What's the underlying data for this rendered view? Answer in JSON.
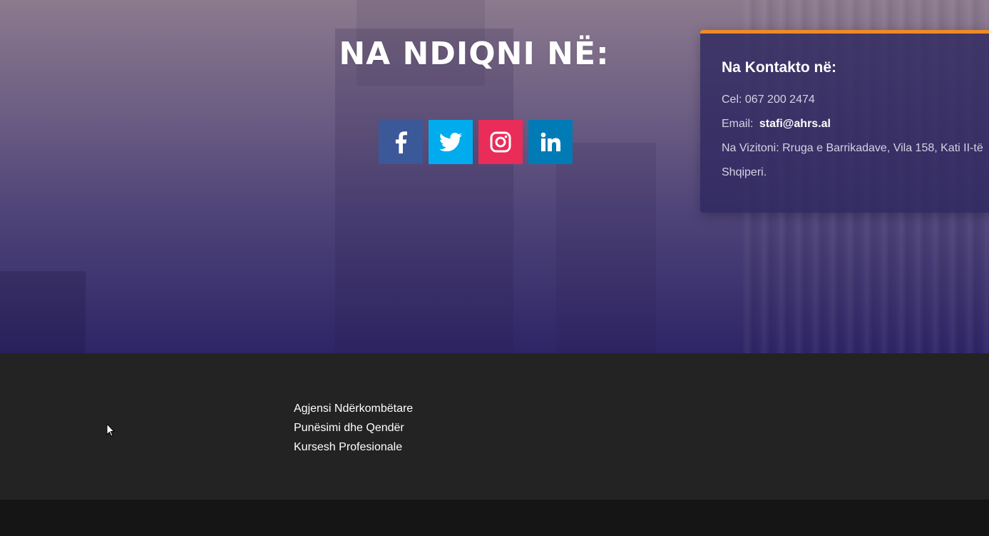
{
  "hero": {
    "follow_title": "NA NDIQNI NË:",
    "social": [
      {
        "name": "facebook",
        "icon": "facebook-icon",
        "color": "#3b5998"
      },
      {
        "name": "twitter",
        "icon": "twitter-icon",
        "color": "#00aced"
      },
      {
        "name": "instagram",
        "icon": "instagram-icon",
        "color": "#ea2c59"
      },
      {
        "name": "linkedin",
        "icon": "linkedin-icon",
        "color": "#007bb6"
      }
    ]
  },
  "contact": {
    "title": "Na Kontakto në:",
    "phone": "Cel: 067 200 2474",
    "email_label": "Email:",
    "email": "stafi@ahrs.al",
    "address_line1": "Na Vizitoni: Rruga e Barrikadave, Vila 158, Kati II-të",
    "address_line2": "Shqiperi.",
    "accent_color": "#f28a25"
  },
  "footer": {
    "links": [
      "Agjensi Ndërkombëtare",
      "Punësimi dhe Qendër",
      "Kursesh Profesionale"
    ]
  }
}
